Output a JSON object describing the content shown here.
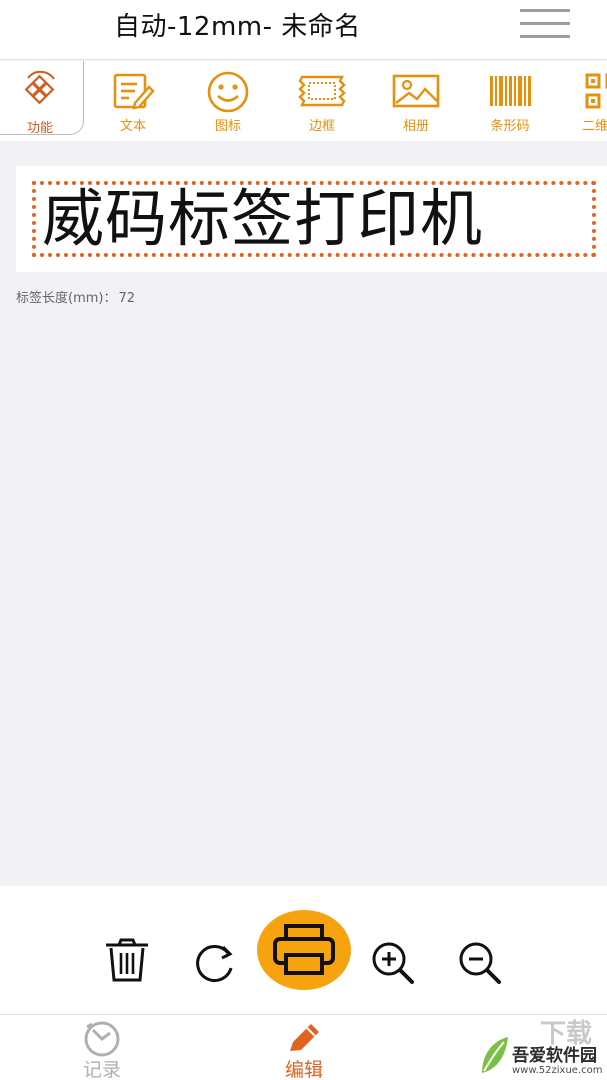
{
  "header": {
    "title": "自动-12mm- 未命名",
    "menu_icon": "hamburger-menu-icon"
  },
  "toolbar": {
    "items": [
      {
        "label": "功能",
        "icon": "function-diamond-icon"
      },
      {
        "label": "文本",
        "icon": "text-edit-icon"
      },
      {
        "label": "图标",
        "icon": "smiley-icon"
      },
      {
        "label": "边框",
        "icon": "border-frame-icon"
      },
      {
        "label": "相册",
        "icon": "photo-album-icon"
      },
      {
        "label": "条形码",
        "icon": "barcode-icon"
      },
      {
        "label": "二维码",
        "icon": "qrcode-icon"
      }
    ]
  },
  "canvas": {
    "label_text": "威码标签打印机",
    "length_label": "标签长度(mm)：",
    "length_value": "72"
  },
  "actions": {
    "icons": [
      "trash-icon",
      "rotate-icon",
      "printer-icon",
      "zoom-in-icon",
      "zoom-out-icon"
    ]
  },
  "bottom_nav": {
    "items": [
      {
        "label": "记录",
        "icon": "record-clock-icon"
      },
      {
        "label": "编辑",
        "icon": "pencil-icon"
      }
    ]
  },
  "watermark": {
    "text": "吾爱软件园",
    "url": "www.52zixue.com",
    "xz": "下载"
  },
  "colors": {
    "accent_orange": "#f7a20f",
    "toolbar_orange": "#e8900e",
    "dotted_border": "#e0631f",
    "background": "#f2f1f6"
  }
}
